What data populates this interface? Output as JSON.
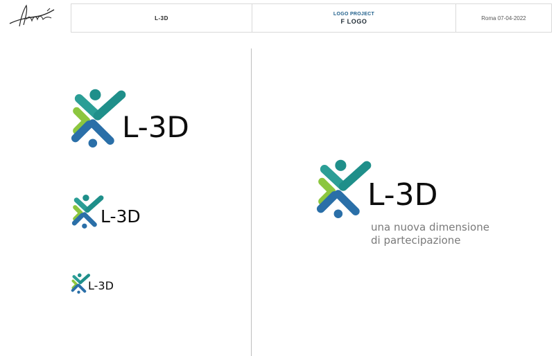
{
  "header": {
    "project_name": "L-3D",
    "section_label": "LOGO PROJECT",
    "section_title": "F LOGO",
    "location_date": "Roma 07-04-2022"
  },
  "logo": {
    "wordmark": "L-3D",
    "tagline_line1": "una nuova dimensione",
    "tagline_line2": "di partecipazione"
  },
  "colors": {
    "teal": "#1f8f8a",
    "blue": "#2a6fa8",
    "light_green": "#8cc63f",
    "green": "#4fae4a",
    "wordmark": "#0d0d0d",
    "tagline": "#7a7a7a"
  }
}
